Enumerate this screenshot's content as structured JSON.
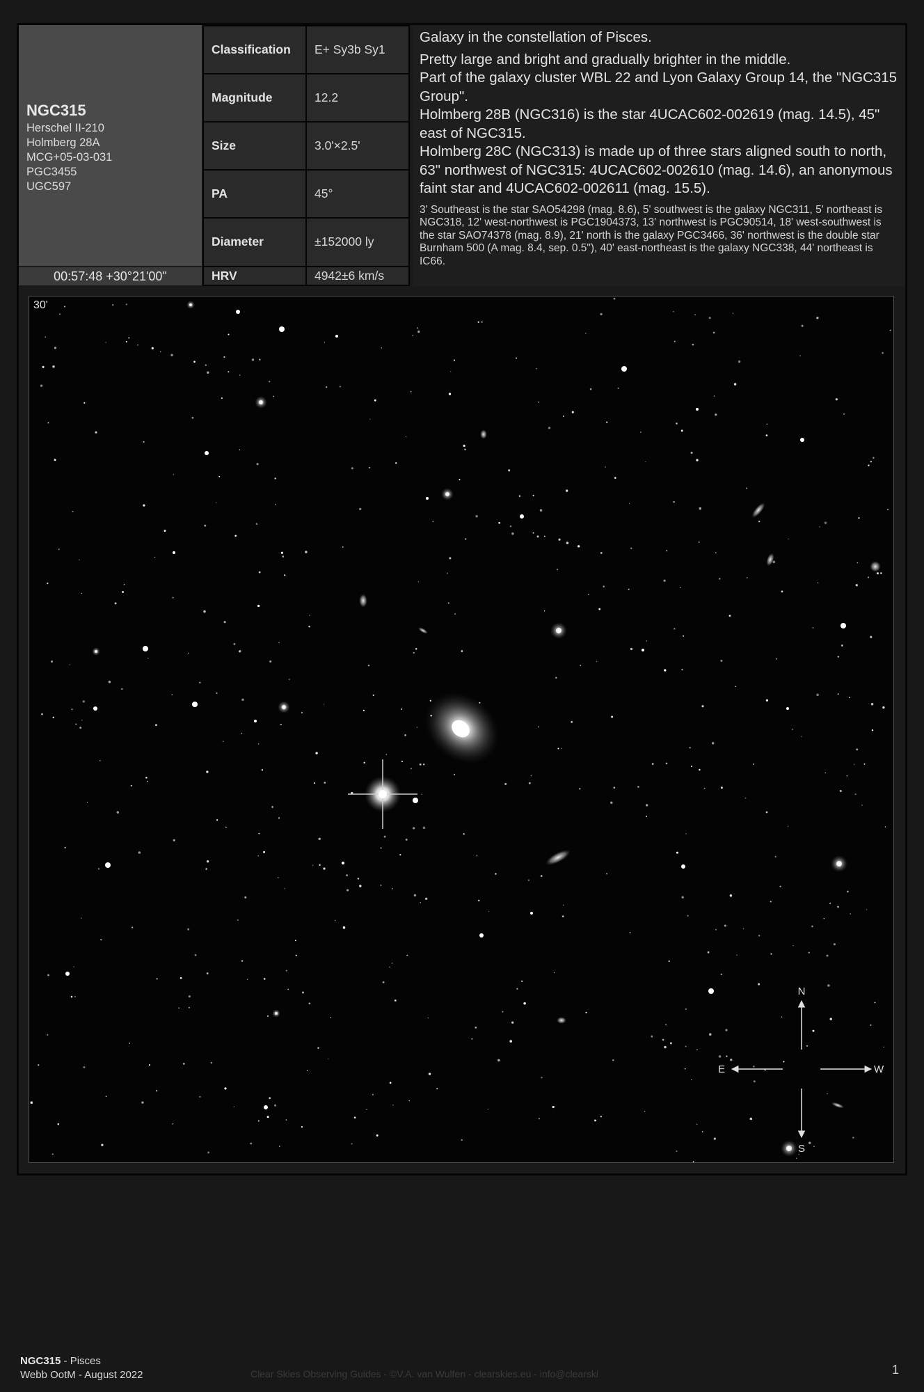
{
  "object": {
    "name": "NGC315",
    "aliases": [
      "Herschel II-210",
      "Holmberg 28A",
      "MCG+05-03-031",
      "PGC3455",
      "UGC597"
    ],
    "coordinates": "00:57:48 +30°21'00\""
  },
  "properties": [
    {
      "label": "Classification",
      "value": "E+ Sy3b Sy1"
    },
    {
      "label": "Magnitude",
      "value": "12.2"
    },
    {
      "label": "Size",
      "value": "3.0'×2.5'"
    },
    {
      "label": "PA",
      "value": "45°"
    },
    {
      "label": "Diameter",
      "value": "±152000 ly"
    },
    {
      "label": "HRV",
      "value": "4942±6 km/s"
    }
  ],
  "description": {
    "constellation": "Galaxy in the constellation of Pisces.",
    "lines": [
      "Pretty large and bright and gradually brighter in the middle.",
      "Part of the galaxy cluster WBL 22 and Lyon Galaxy Group 14, the \"NGC315 Group\".",
      "Holmberg 28B (NGC316) is the star 4UCAC602-002619 (mag. 14.5), 45\" east of NGC315.",
      "Holmberg 28C (NGC313) is made up of three stars aligned south to north, 63\" northwest of NGC315: 4UCAC602-002610 (mag. 14.6), an anonymous faint star and 4UCAC602-002611 (mag. 15.5)."
    ],
    "surroundings": "3' Southeast is the star SAO54298 (mag. 8.6), 5' southwest is the galaxy NGC311, 5' northeast is NGC318, 12' west-northwest is PGC1904373, 13' northwest is PGC90514, 18' west-southwest is the star SAO74378 (mag. 8.9), 21' north is the galaxy PGC3466, 36' northwest is the double star Burnham 500 (A mag. 8.4, sep. 0.5\"), 40' east-northeast is the galaxy NGC338, 44' northeast is IC66."
  },
  "image": {
    "scale_label": "30'",
    "compass": {
      "north": "N",
      "south": "S",
      "east": "E",
      "west": "W"
    }
  },
  "footer": {
    "object": "NGC315",
    "constellation": " - Pisces",
    "series": "Webb OotM - August 2022",
    "credit": "Clear Skies Observing Guides - ©V.A. van Wulfen - clearskies.eu - info@clearski",
    "page": "1"
  }
}
